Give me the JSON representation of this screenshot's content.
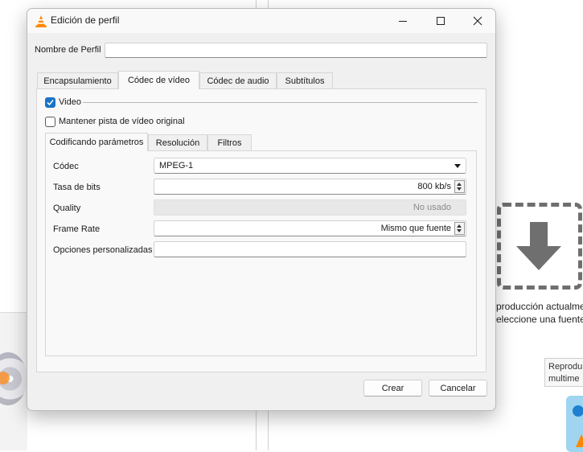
{
  "window": {
    "title": "Edición de perfil"
  },
  "profile": {
    "name_label": "Nombre de Perfil",
    "name_value": ""
  },
  "tabs": [
    {
      "label": "Encapsulamiento"
    },
    {
      "label": "Códec de vídeo",
      "active": true
    },
    {
      "label": "Códec de audio"
    },
    {
      "label": "Subtítulos"
    }
  ],
  "video": {
    "video_checkbox_label": "Video",
    "video_checked": true,
    "keep_original_label": "Mantener pista de vídeo original",
    "keep_original_checked": false
  },
  "subtabs": [
    {
      "label": "Codificando parámetros",
      "active": true
    },
    {
      "label": "Resolución"
    },
    {
      "label": "Filtros"
    }
  ],
  "params": {
    "codec_label": "Códec",
    "codec_value": "MPEG-1",
    "bitrate_label": "Tasa de bits",
    "bitrate_value": "800 kb/s",
    "quality_label": "Quality",
    "quality_value": "No usado",
    "framerate_label": "Frame Rate",
    "framerate_value": "Mismo que fuente",
    "custom_label": "Opciones personalizadas",
    "custom_value": ""
  },
  "buttons": {
    "create": "Crear",
    "cancel": "Cancelar"
  },
  "background": {
    "line1": "producción actualme",
    "line2": "eleccione una fuente",
    "tooltip_line1": "Reprodu",
    "tooltip_line2": "multime"
  },
  "colors": {
    "accent": "#1a73c8",
    "vlc_orange": "#ff8800"
  }
}
